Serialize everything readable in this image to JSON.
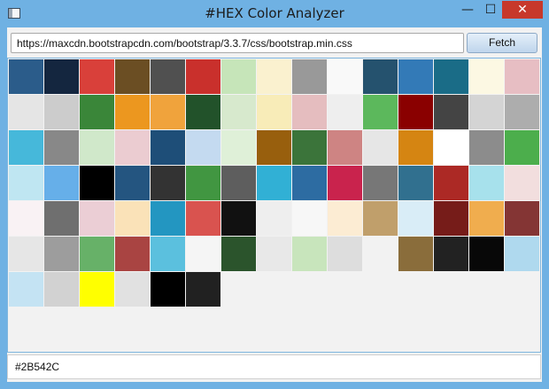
{
  "window": {
    "title": "#HEX Color Analyzer",
    "controls": {
      "minimize": "—",
      "maximize": "☐",
      "close": "✕"
    }
  },
  "toolbar": {
    "url": "https://maxcdn.bootstrapcdn.com/bootstrap/3.3.7/css/bootstrap.min.css",
    "fetch_label": "Fetch"
  },
  "swatches": [
    "#2B5C8A",
    "#14263F",
    "#D9403A",
    "#6B4E23",
    "#505050",
    "#C9302C",
    "#C6E5B9",
    "#FAF1CF",
    "#999999",
    "#F9F9F9",
    "#25526E",
    "#337AB7",
    "#1A6C87",
    "#FCF8E3",
    "#E7BEC3",
    "#E5E5E5",
    "#CCCCCC",
    "#3A8639",
    "#EC971F",
    "#F0A33C",
    "#22522A",
    "#D7E9CD",
    "#F8ECB8",
    "#E5BDBF",
    "#EEEEEE",
    "#5CB85C",
    "#8A0000",
    "#444444",
    "#D4D4D4",
    "#ADADAD",
    "#46B8DA",
    "#888888",
    "#D0E8CA",
    "#EBCCD1",
    "#1E4E78",
    "#C4DAF0",
    "#DFF0D8",
    "#985F0D",
    "#3B743A",
    "#CE8483",
    "#E6E6E6",
    "#D58512",
    "#FFFFFF",
    "#8C8C8C",
    "#4CAE4C",
    "#BFE6F2",
    "#66AFE9",
    "#000000",
    "#245580",
    "#333333",
    "#419641",
    "#5E5E5E",
    "#31B0D5",
    "#2D6CA2",
    "#C9234D",
    "#777777",
    "#31708F",
    "#AC2925",
    "#A7E1EC",
    "#F2DEDE",
    "#F9F2F4",
    "#6F6F6F",
    "#EBCED5",
    "#FAE2B8",
    "#2396C1",
    "#D9534F",
    "#111111",
    "#EEEEEE",
    "#F7F7F7",
    "#FCECD3",
    "#C09F6B",
    "#D9EDF7",
    "#761C19",
    "#F0AD4E",
    "#843534",
    "#E6E6E6",
    "#9D9D9D",
    "#67B168",
    "#A94442",
    "#5BC0DE",
    "#F5F5F5",
    "#2B542C",
    "#E8E8E8",
    "#C8E5BC",
    "#DDDDDD",
    "#F2F2F2",
    "#8A6D3B",
    "#222222",
    "#080808",
    "#AFD9EE",
    "#C4E3F3",
    "#D2D2D2",
    "#FFFF00",
    "#E1E1E1",
    "#000000",
    "#212121"
  ],
  "status": {
    "selected_hex": "#2B542C"
  }
}
